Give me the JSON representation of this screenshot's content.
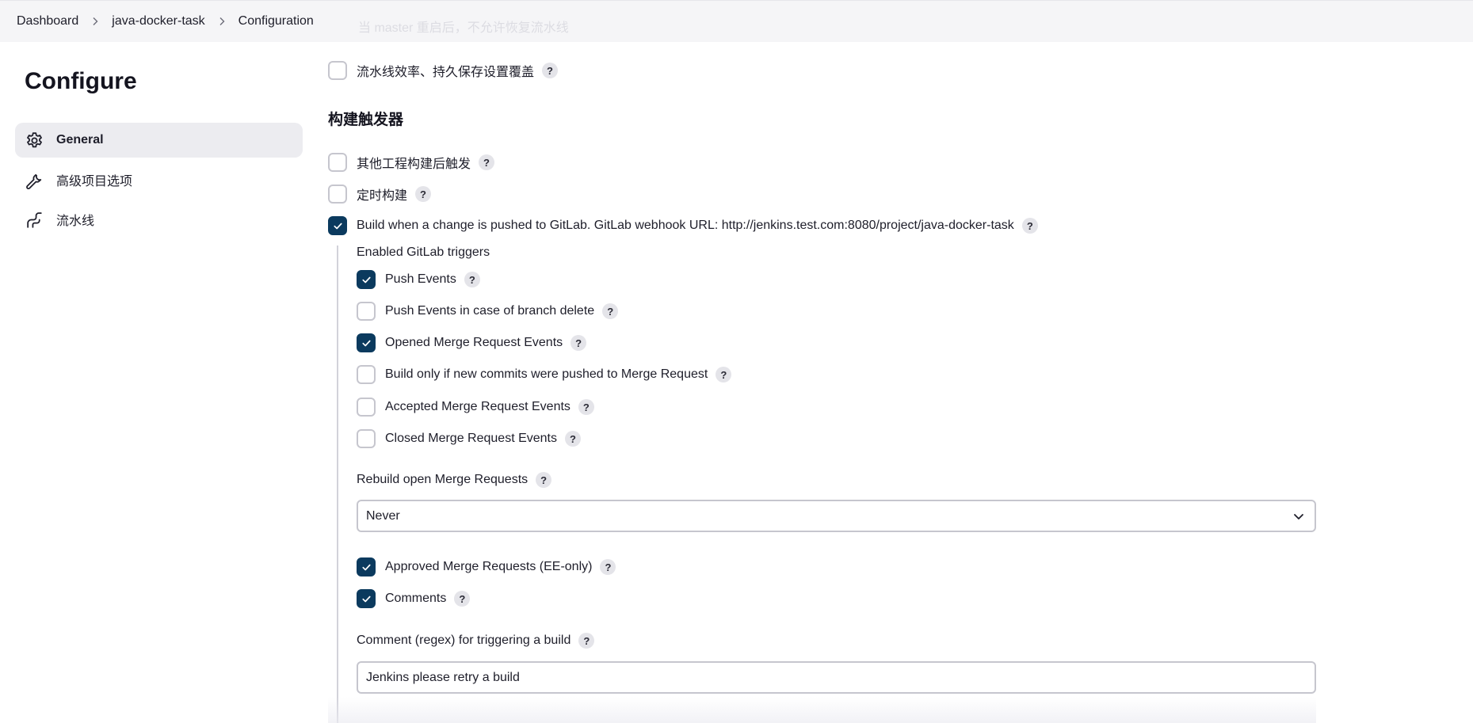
{
  "breadcrumb": {
    "items": [
      "Dashboard",
      "java-docker-task",
      "Configuration"
    ]
  },
  "faded_text": "当 master 重启后，不允许恢复流水线",
  "sidebar": {
    "title": "Configure",
    "items": [
      {
        "label": "General",
        "icon": "gear-icon",
        "active": true
      },
      {
        "label": "高级项目选项",
        "icon": "wrench-icon",
        "active": false
      },
      {
        "label": "流水线",
        "icon": "pipeline-icon",
        "active": false
      }
    ]
  },
  "main": {
    "pipeline_override": {
      "label": "流水线效率、持久保存设置覆盖",
      "checked": false
    },
    "triggers_title": "构建触发器",
    "triggers": [
      {
        "label": "其他工程构建后触发",
        "checked": false
      },
      {
        "label": "定时构建",
        "checked": false
      },
      {
        "label": "Build when a change is pushed to GitLab. GitLab webhook URL: http://jenkins.test.com:8080/project/java-docker-task",
        "checked": true
      }
    ],
    "gitlab": {
      "heading": "Enabled GitLab triggers",
      "options": [
        {
          "label": "Push Events",
          "checked": true
        },
        {
          "label": "Push Events in case of branch delete",
          "checked": false
        },
        {
          "label": "Opened Merge Request Events",
          "checked": true
        },
        {
          "label": "Build only if new commits were pushed to Merge Request",
          "checked": false
        },
        {
          "label": "Accepted Merge Request Events",
          "checked": false
        },
        {
          "label": "Closed Merge Request Events",
          "checked": false
        }
      ],
      "rebuild_label": "Rebuild open Merge Requests",
      "rebuild_value": "Never",
      "extra_options": [
        {
          "label": "Approved Merge Requests (EE-only)",
          "checked": true
        },
        {
          "label": "Comments",
          "checked": true
        }
      ],
      "comment_label": "Comment (regex) for triggering a build",
      "comment_value": "Jenkins please retry a build"
    }
  },
  "help_glyph": "?",
  "colors": {
    "accent": "#0b3a5e",
    "active_bg": "#ececf0",
    "topbar_bg": "#f5f5f7"
  }
}
